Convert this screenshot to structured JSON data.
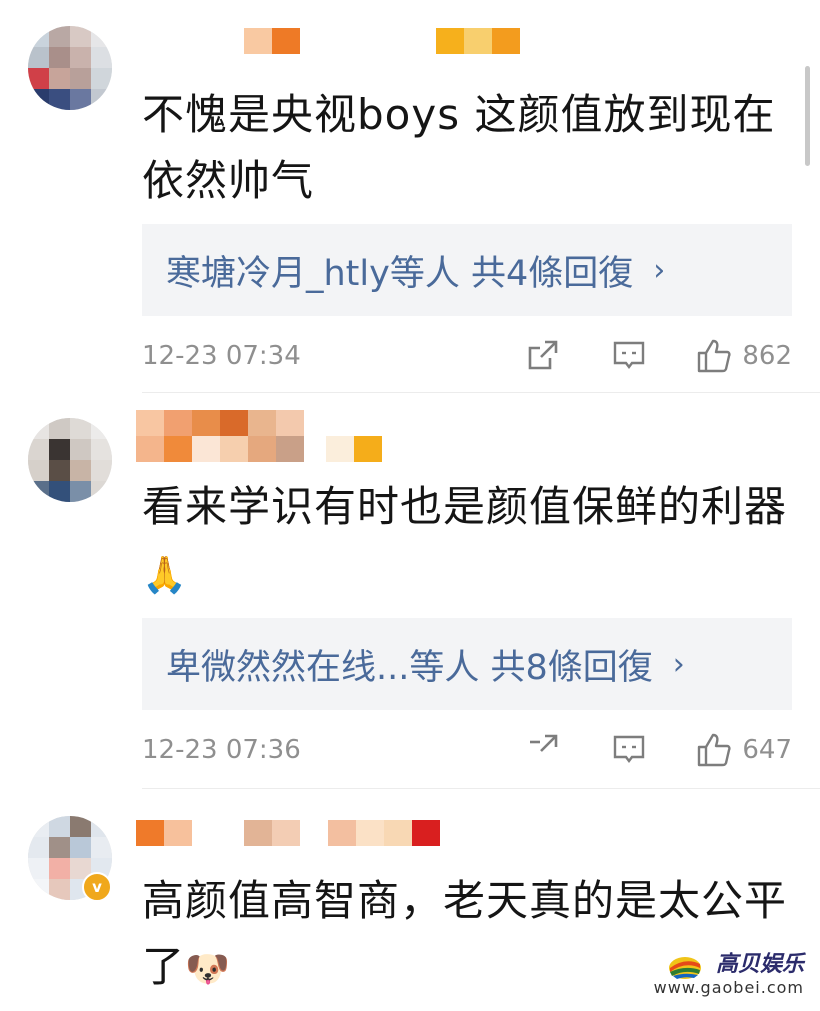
{
  "comments": [
    {
      "text": "不愧是央视boys 这颜值放到现在依然帅气",
      "reply_summary": "寒塘冷月_htly等人 共4條回復",
      "time": "12-23 07:34",
      "likes": "862"
    },
    {
      "text": "看来学识有时也是颜值保鲜的利器",
      "emoji": "🙏",
      "reply_summary": "卑微然然在线...等人 共8條回復",
      "time": "12-23 07:36",
      "likes": "647"
    },
    {
      "text": "高颜值高智商，老天真的是太公平了",
      "emoji": "🐶",
      "verified_badge": "v"
    }
  ],
  "reply_chevron": "›",
  "watermark": {
    "title": "高贝娱乐",
    "url": "www.gaobei.com"
  },
  "colors": {
    "reply_link": "#4a6a9a",
    "meta_text": "#8f8f8f",
    "reply_bg": "#f3f4f6",
    "verified": "#f0a81c"
  }
}
